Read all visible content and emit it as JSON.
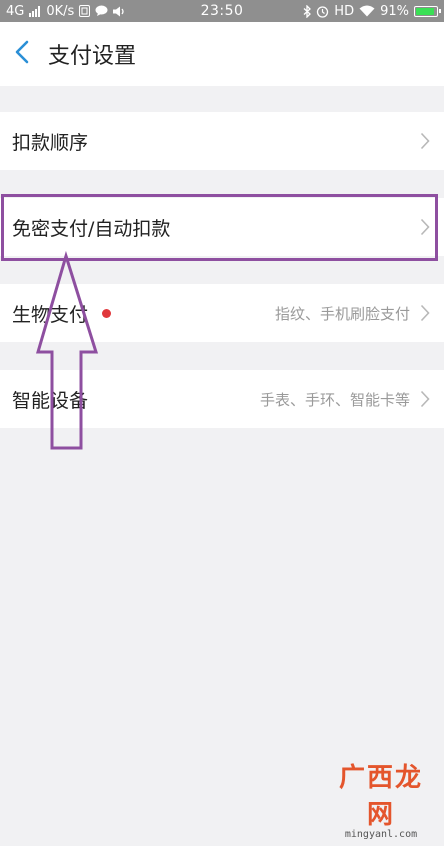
{
  "status_bar": {
    "network": "4G",
    "signal_icon": "signal-bars-icon",
    "speed": "0K/s",
    "icons_left": [
      "sim-icon",
      "chat-bubble-icon",
      "speaker-icon"
    ],
    "time": "23:50",
    "icons_right": [
      "bluetooth-icon",
      "alarm-icon"
    ],
    "hd": "HD",
    "wifi_icon": "wifi-icon",
    "battery": "91%",
    "battery_level": 0.91,
    "battery_color": "#3adf55"
  },
  "header": {
    "back_icon": "chevron-left-icon",
    "title": "支付设置",
    "accent": "#2a8fd6"
  },
  "settings": {
    "items": [
      {
        "label": "扣款顺序",
        "value": ""
      },
      {
        "label": "免密支付/自动扣款",
        "value": ""
      },
      {
        "label": "生物支付",
        "value": "指纹、手机刷脸支付",
        "badge": "red-dot"
      },
      {
        "label": "智能设备",
        "value": "手表、手环、智能卡等"
      }
    ]
  },
  "annotation": {
    "color": "#8e4fa0",
    "shape": "highlight-box-with-up-arrow"
  },
  "watermark": {
    "main": "广西龙网",
    "sub": "mingyanl.com"
  }
}
